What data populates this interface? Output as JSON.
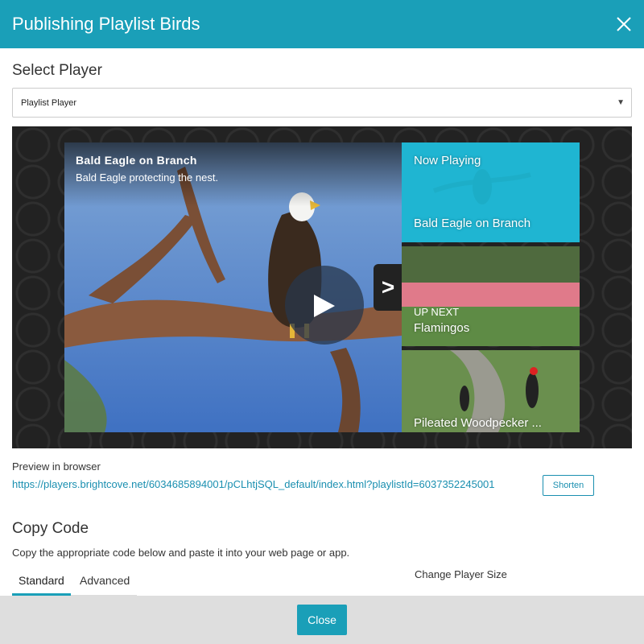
{
  "header": {
    "title": "Publishing Playlist Birds"
  },
  "select_player": {
    "heading": "Select Player",
    "selected": "Playlist Player"
  },
  "player": {
    "video_title": "Bald Eagle on Branch",
    "video_description": "Bald Eagle protecting the nest.",
    "next_arrow": ">",
    "playlist": [
      {
        "status": "Now Playing",
        "title": "Bald Eagle on Branch"
      },
      {
        "status": "UP NEXT",
        "title": "Flamingos"
      },
      {
        "status": "",
        "title": "Pileated Woodpecker ..."
      }
    ]
  },
  "preview": {
    "label": "Preview in browser",
    "url": "https://players.brightcove.net/6034685894001/pCLhtjSQL_default/index.html?playlistId=6037352245001",
    "shorten_label": "Shorten"
  },
  "copy_code": {
    "heading": "Copy Code",
    "description": "Copy the appropriate code below and paste it into your web page or app.",
    "tabs": [
      "Standard",
      "Advanced"
    ],
    "change_size_label": "Change Player Size"
  },
  "footer": {
    "close_label": "Close"
  },
  "colors": {
    "accent": "#1a9fb8",
    "link": "#1a8fb0",
    "now_playing": "#1ab9d6",
    "footer_bg": "#dedede"
  }
}
